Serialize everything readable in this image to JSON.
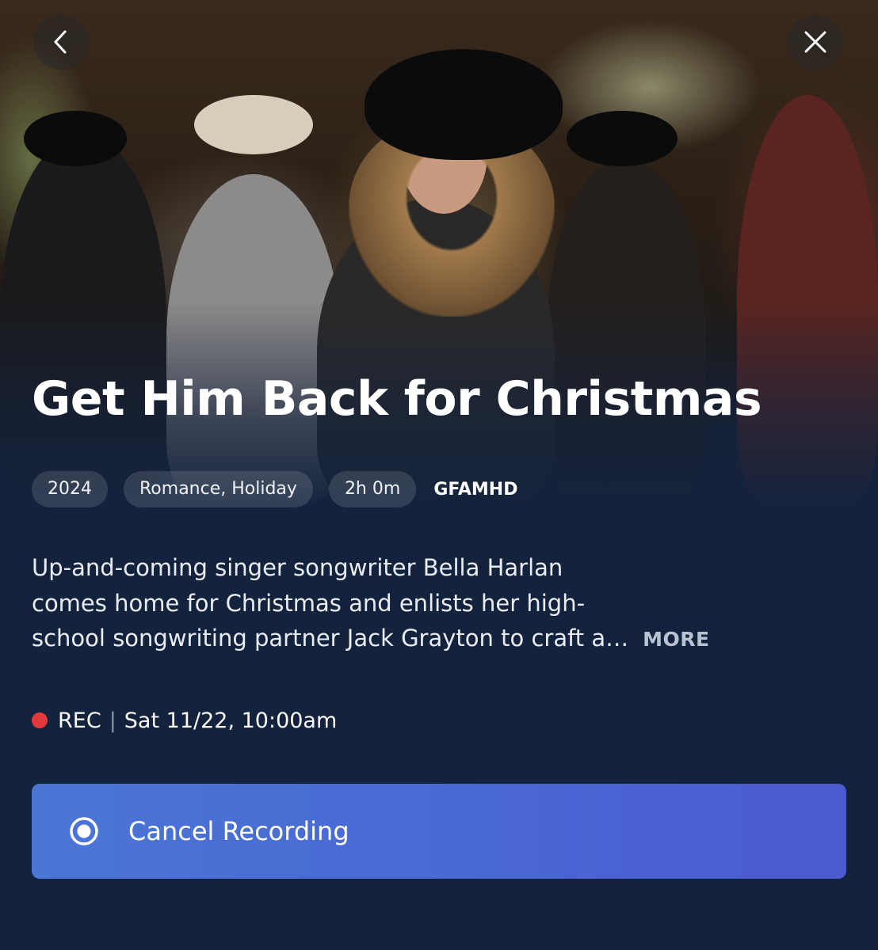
{
  "header": {
    "back_icon": "chevron-left-icon",
    "close_icon": "close-icon"
  },
  "program": {
    "title": "Get Him Back for Christmas",
    "year": "2024",
    "genres": "Romance, Holiday",
    "duration": "2h 0m",
    "channel": "GFAMHD",
    "description_lines": [
      "Up-and-coming singer songwriter Bella Harlan",
      "comes home for Christmas and enlists her high-",
      "school songwriting partner Jack Grayton to craft a…"
    ],
    "more_label": "MORE"
  },
  "recording": {
    "status": "REC",
    "separator": "|",
    "schedule": "Sat 11/22, 10:00am",
    "dot_color": "#e23a3a"
  },
  "action": {
    "label": "Cancel Recording",
    "icon": "record-radio-icon",
    "color": "#4966d2"
  }
}
